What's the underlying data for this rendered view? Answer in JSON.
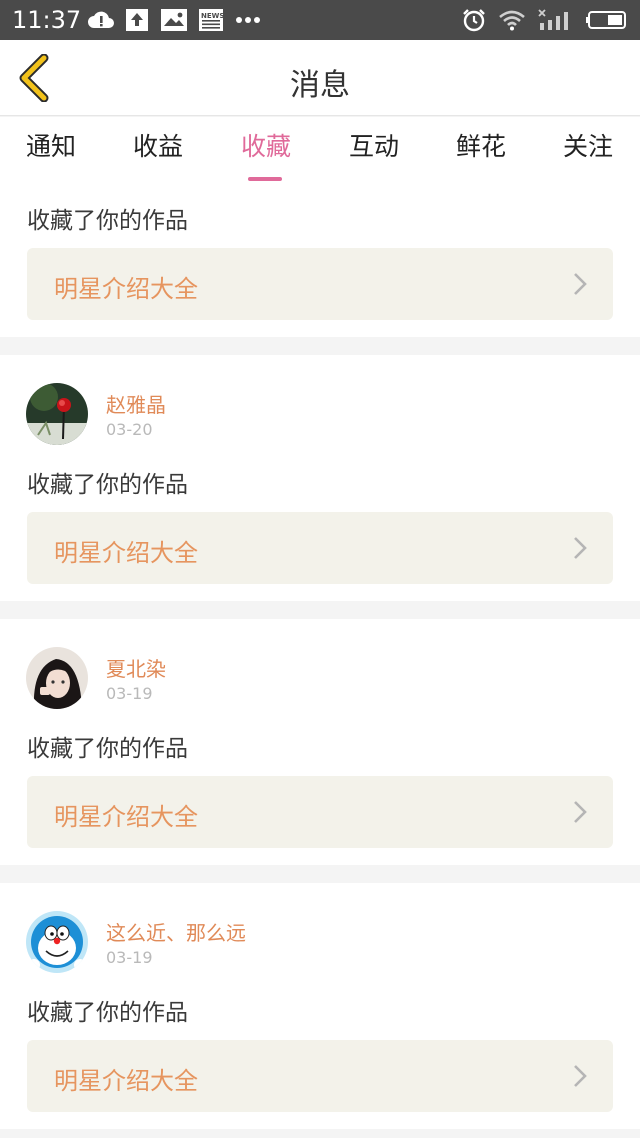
{
  "status_bar": {
    "time": "11:37",
    "icons_left": [
      "cloud-alert-icon",
      "upload-icon",
      "image-icon",
      "news-icon",
      "more-dots-icon"
    ],
    "news_label": "NEWS",
    "icons_right": [
      "alarm-icon",
      "wifi-icon",
      "signal-icon",
      "battery-icon"
    ]
  },
  "header": {
    "title": "消息",
    "back_icon": "chevron-left-icon",
    "accent": "#f2c21b"
  },
  "tabs": [
    {
      "label": "通知",
      "active": false
    },
    {
      "label": "收益",
      "active": false
    },
    {
      "label": "收藏",
      "active": true
    },
    {
      "label": "互动",
      "active": false
    },
    {
      "label": "鲜花",
      "active": false
    },
    {
      "label": "关注",
      "active": false
    }
  ],
  "colors": {
    "active_tab": "#e06a9a",
    "username": "#e08a58",
    "work_title": "#e6955f",
    "work_bg": "#f3f2ea"
  },
  "items": [
    {
      "user": "",
      "date": "",
      "action": "收藏了你的作品",
      "work_title": "明星介绍大全",
      "avatar_icon": ""
    },
    {
      "user": "赵雅晶",
      "date": "03-20",
      "action": "收藏了你的作品",
      "work_title": "明星介绍大全",
      "avatar_icon": "rose-avatar"
    },
    {
      "user": "夏北染",
      "date": "03-19",
      "action": "收藏了你的作品",
      "work_title": "明星介绍大全",
      "avatar_icon": "girl-photo-avatar"
    },
    {
      "user": "这么近、那么远",
      "date": "03-19",
      "action": "收藏了你的作品",
      "work_title": "明星介绍大全",
      "avatar_icon": "cartoon-cat-avatar"
    }
  ]
}
